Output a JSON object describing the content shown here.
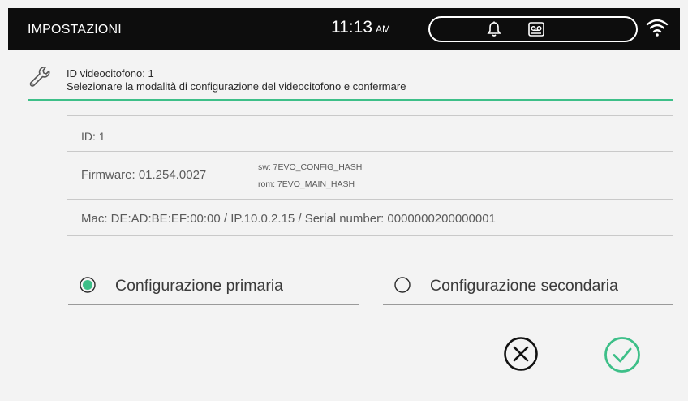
{
  "statusbar": {
    "title": "IMPOSTAZIONI",
    "time": "11:13",
    "ampm": "AM",
    "icons": [
      "bell-icon",
      "voicemail-icon",
      "wifi-icon"
    ]
  },
  "header": {
    "line1": "ID videocitofono: 1",
    "line2": "Selezionare la modalità di configurazione del videocitofono e confermare",
    "icon": "wrench-icon",
    "accent_color": "#3dbf88"
  },
  "info": {
    "id": "ID: 1",
    "firmware": "Firmware: 01.254.0027",
    "sw": "sw: 7EVO_CONFIG_HASH",
    "rom": "rom: 7EVO_MAIN_HASH",
    "network": "Mac: DE:AD:BE:EF:00:00 / IP.10.0.2.15 / Serial number: 0000000200000001"
  },
  "options": {
    "primary": {
      "label": "Configurazione primaria",
      "selected": true
    },
    "secondary": {
      "label": "Configurazione secondaria",
      "selected": false
    }
  },
  "actions": {
    "cancel_icon": "cancel-circle-icon",
    "confirm_icon": "check-circle-icon",
    "confirm_color": "#3dbf88"
  }
}
